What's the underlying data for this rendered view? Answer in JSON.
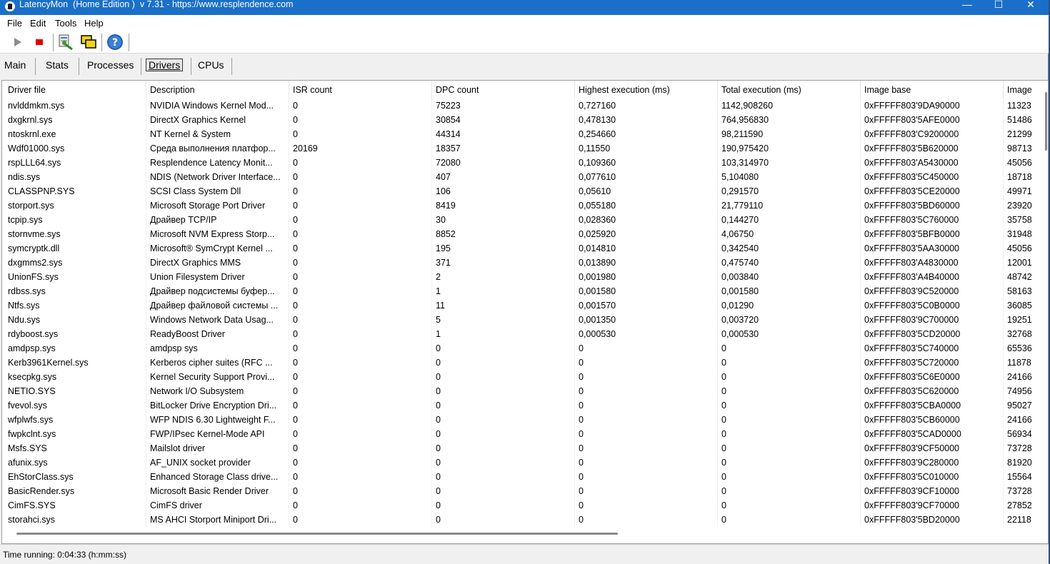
{
  "window": {
    "title": "LatencyMon  (Home Edition )  v 7.31 - https://www.resplendence.com",
    "min_glyph": "—",
    "max_glyph": "☐",
    "close_glyph": "✕"
  },
  "menu": {
    "items": [
      "File",
      "Edit",
      "Tools",
      "Help"
    ]
  },
  "toolbar": {
    "buttons": [
      "play-icon",
      "stop-icon",
      "driver-lookup-icon",
      "windows-icon",
      "help-icon"
    ],
    "colors": {
      "play": "#8c8c8c",
      "stop": "#e00000",
      "help": "#1e5fb5"
    }
  },
  "tabs": {
    "items": [
      "Main",
      "Stats",
      "Processes",
      "Drivers",
      "CPUs"
    ],
    "active": "Drivers"
  },
  "table": {
    "columns": [
      "Driver file",
      "Description",
      "ISR count",
      "DPC count",
      "Highest execution (ms)",
      "Total execution (ms)",
      "Image base",
      "Image"
    ],
    "rows": [
      [
        "nvlddmkm.sys",
        "NVIDIA Windows Kernel Mod...",
        "0",
        "75223",
        "0,727160",
        "1142,908260",
        "0xFFFFF803'9DA90000",
        "11323"
      ],
      [
        "dxgkrnl.sys",
        "DirectX Graphics Kernel",
        "0",
        "30854",
        "0,478130",
        "764,956830",
        "0xFFFFF803'5AFE0000",
        "51486"
      ],
      [
        "ntoskrnl.exe",
        "NT Kernel & System",
        "0",
        "44314",
        "0,254660",
        "98,211590",
        "0xFFFFF803'C9200000",
        "21299"
      ],
      [
        "Wdf01000.sys",
        "Среда выполнения платфор...",
        "20169",
        "18357",
        "0,11550",
        "190,975420",
        "0xFFFFF803'5B620000",
        "98713"
      ],
      [
        "rspLLL64.sys",
        "Resplendence Latency Monit...",
        "0",
        "72080",
        "0,109360",
        "103,314970",
        "0xFFFFF803'A5430000",
        "45056"
      ],
      [
        "ndis.sys",
        "NDIS (Network Driver Interface...",
        "0",
        "407",
        "0,077610",
        "5,104080",
        "0xFFFFF803'5C450000",
        "18718"
      ],
      [
        "CLASSPNP.SYS",
        "SCSI Class System Dll",
        "0",
        "106",
        "0,05610",
        "0,291570",
        "0xFFFFF803'5CE20000",
        "49971"
      ],
      [
        "storport.sys",
        "Microsoft Storage Port Driver",
        "0",
        "8419",
        "0,055180",
        "21,779110",
        "0xFFFFF803'5BD60000",
        "23920"
      ],
      [
        "tcpip.sys",
        "Драйвер TCP/IP",
        "0",
        "30",
        "0,028360",
        "0,144270",
        "0xFFFFF803'5C760000",
        "35758"
      ],
      [
        "stornvme.sys",
        "Microsoft NVM Express Storp...",
        "0",
        "8852",
        "0,025920",
        "4,06750",
        "0xFFFFF803'5BFB0000",
        "31948"
      ],
      [
        "symcryptk.dll",
        "Microsoft® SymCrypt Kernel ...",
        "0",
        "195",
        "0,014810",
        "0,342540",
        "0xFFFFF803'5AA30000",
        "45056"
      ],
      [
        "dxgmms2.sys",
        "DirectX Graphics MMS",
        "0",
        "371",
        "0,013890",
        "0,475740",
        "0xFFFFF803'A4830000",
        "12001"
      ],
      [
        "UnionFS.sys",
        "Union Filesystem Driver",
        "0",
        "2",
        "0,001980",
        "0,003840",
        "0xFFFFF803'A4B40000",
        "48742"
      ],
      [
        "rdbss.sys",
        "Драйвер подсистемы буфер...",
        "0",
        "1",
        "0,001580",
        "0,001580",
        "0xFFFFF803'9C520000",
        "58163"
      ],
      [
        "Ntfs.sys",
        "Драйвер файловой системы ...",
        "0",
        "11",
        "0,001570",
        "0,01290",
        "0xFFFFF803'5C0B0000",
        "36085"
      ],
      [
        "Ndu.sys",
        "Windows Network Data Usag...",
        "0",
        "5",
        "0,001350",
        "0,003720",
        "0xFFFFF803'9C700000",
        "19251"
      ],
      [
        "rdyboost.sys",
        "ReadyBoost Driver",
        "0",
        "1",
        "0,000530",
        "0,000530",
        "0xFFFFF803'5CD20000",
        "32768"
      ],
      [
        "amdpsp.sys",
        "amdpsp sys",
        "0",
        "0",
        "0",
        "0",
        "0xFFFFF803'5C740000",
        "65536"
      ],
      [
        "Kerb3961Kernel.sys",
        "Kerberos cipher suites (RFC ...",
        "0",
        "0",
        "0",
        "0",
        "0xFFFFF803'5C720000",
        "11878"
      ],
      [
        "ksecpkg.sys",
        "Kernel Security Support Provi...",
        "0",
        "0",
        "0",
        "0",
        "0xFFFFF803'5C6E0000",
        "24166"
      ],
      [
        "NETIO.SYS",
        "Network I/O Subsystem",
        "0",
        "0",
        "0",
        "0",
        "0xFFFFF803'5C620000",
        "74956"
      ],
      [
        "fvevol.sys",
        "BitLocker Drive Encryption Dri...",
        "0",
        "0",
        "0",
        "0",
        "0xFFFFF803'5CBA0000",
        "95027"
      ],
      [
        "wfplwfs.sys",
        "WFP NDIS 6.30 Lightweight F...",
        "0",
        "0",
        "0",
        "0",
        "0xFFFFF803'5CB60000",
        "24166"
      ],
      [
        "fwpkclnt.sys",
        "FWP/IPsec Kernel-Mode API",
        "0",
        "0",
        "0",
        "0",
        "0xFFFFF803'5CAD0000",
        "56934"
      ],
      [
        "Msfs.SYS",
        "Mailslot driver",
        "0",
        "0",
        "0",
        "0",
        "0xFFFFF803'9CF50000",
        "73728"
      ],
      [
        "afunix.sys",
        "AF_UNIX socket provider",
        "0",
        "0",
        "0",
        "0",
        "0xFFFFF803'9C280000",
        "81920"
      ],
      [
        "EhStorClass.sys",
        "Enhanced Storage Class drive...",
        "0",
        "0",
        "0",
        "0",
        "0xFFFFF803'5C010000",
        "15564"
      ],
      [
        "BasicRender.sys",
        "Microsoft Basic Render Driver",
        "0",
        "0",
        "0",
        "0",
        "0xFFFFF803'9CF10000",
        "73728"
      ],
      [
        "CimFS.SYS",
        "CimFS driver",
        "0",
        "0",
        "0",
        "0",
        "0xFFFFF803'9CF70000",
        "27852"
      ],
      [
        "storahci.sys",
        "MS AHCI Storport Miniport Dri...",
        "0",
        "0",
        "0",
        "0",
        "0xFFFFF803'5BD20000",
        "22118"
      ]
    ]
  },
  "status": {
    "text": "Time running: 0:04:33  (h:mm:ss)"
  }
}
